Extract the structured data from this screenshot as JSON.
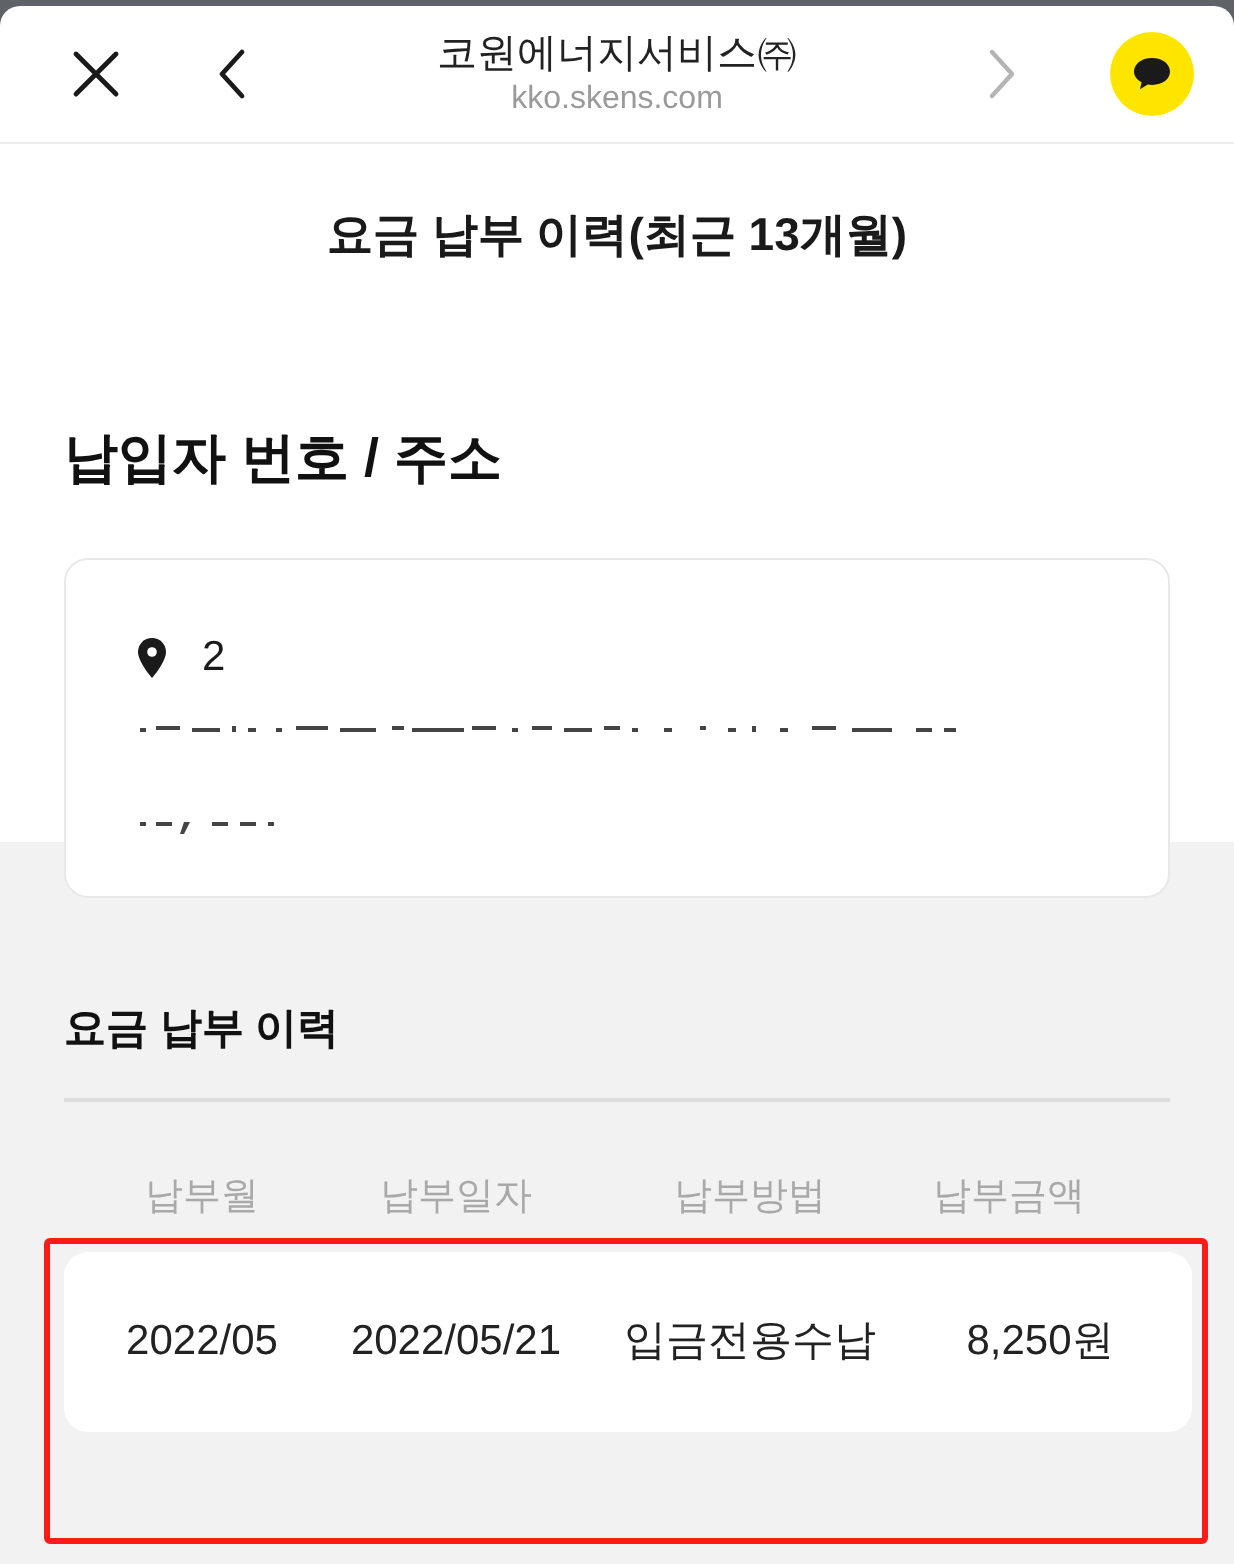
{
  "browser_bar": {
    "title": "코원에너지서비스㈜",
    "url": "kko.skens.com",
    "forward_disabled": true
  },
  "page_title": "요금 납부 이력(최근 13개월)",
  "payer_section": {
    "heading": "납입자 번호 / 주소",
    "address": "2",
    "address_masked": true
  },
  "history": {
    "heading": "요금 납부 이력",
    "columns": [
      "납부월",
      "납부일자",
      "납부방법",
      "납부금액"
    ],
    "rows_highlighted": true,
    "rows": [
      {
        "cells": [
          "2022/05",
          "2022/05/21",
          "입금전용수납",
          "8,250원"
        ]
      }
    ]
  }
}
